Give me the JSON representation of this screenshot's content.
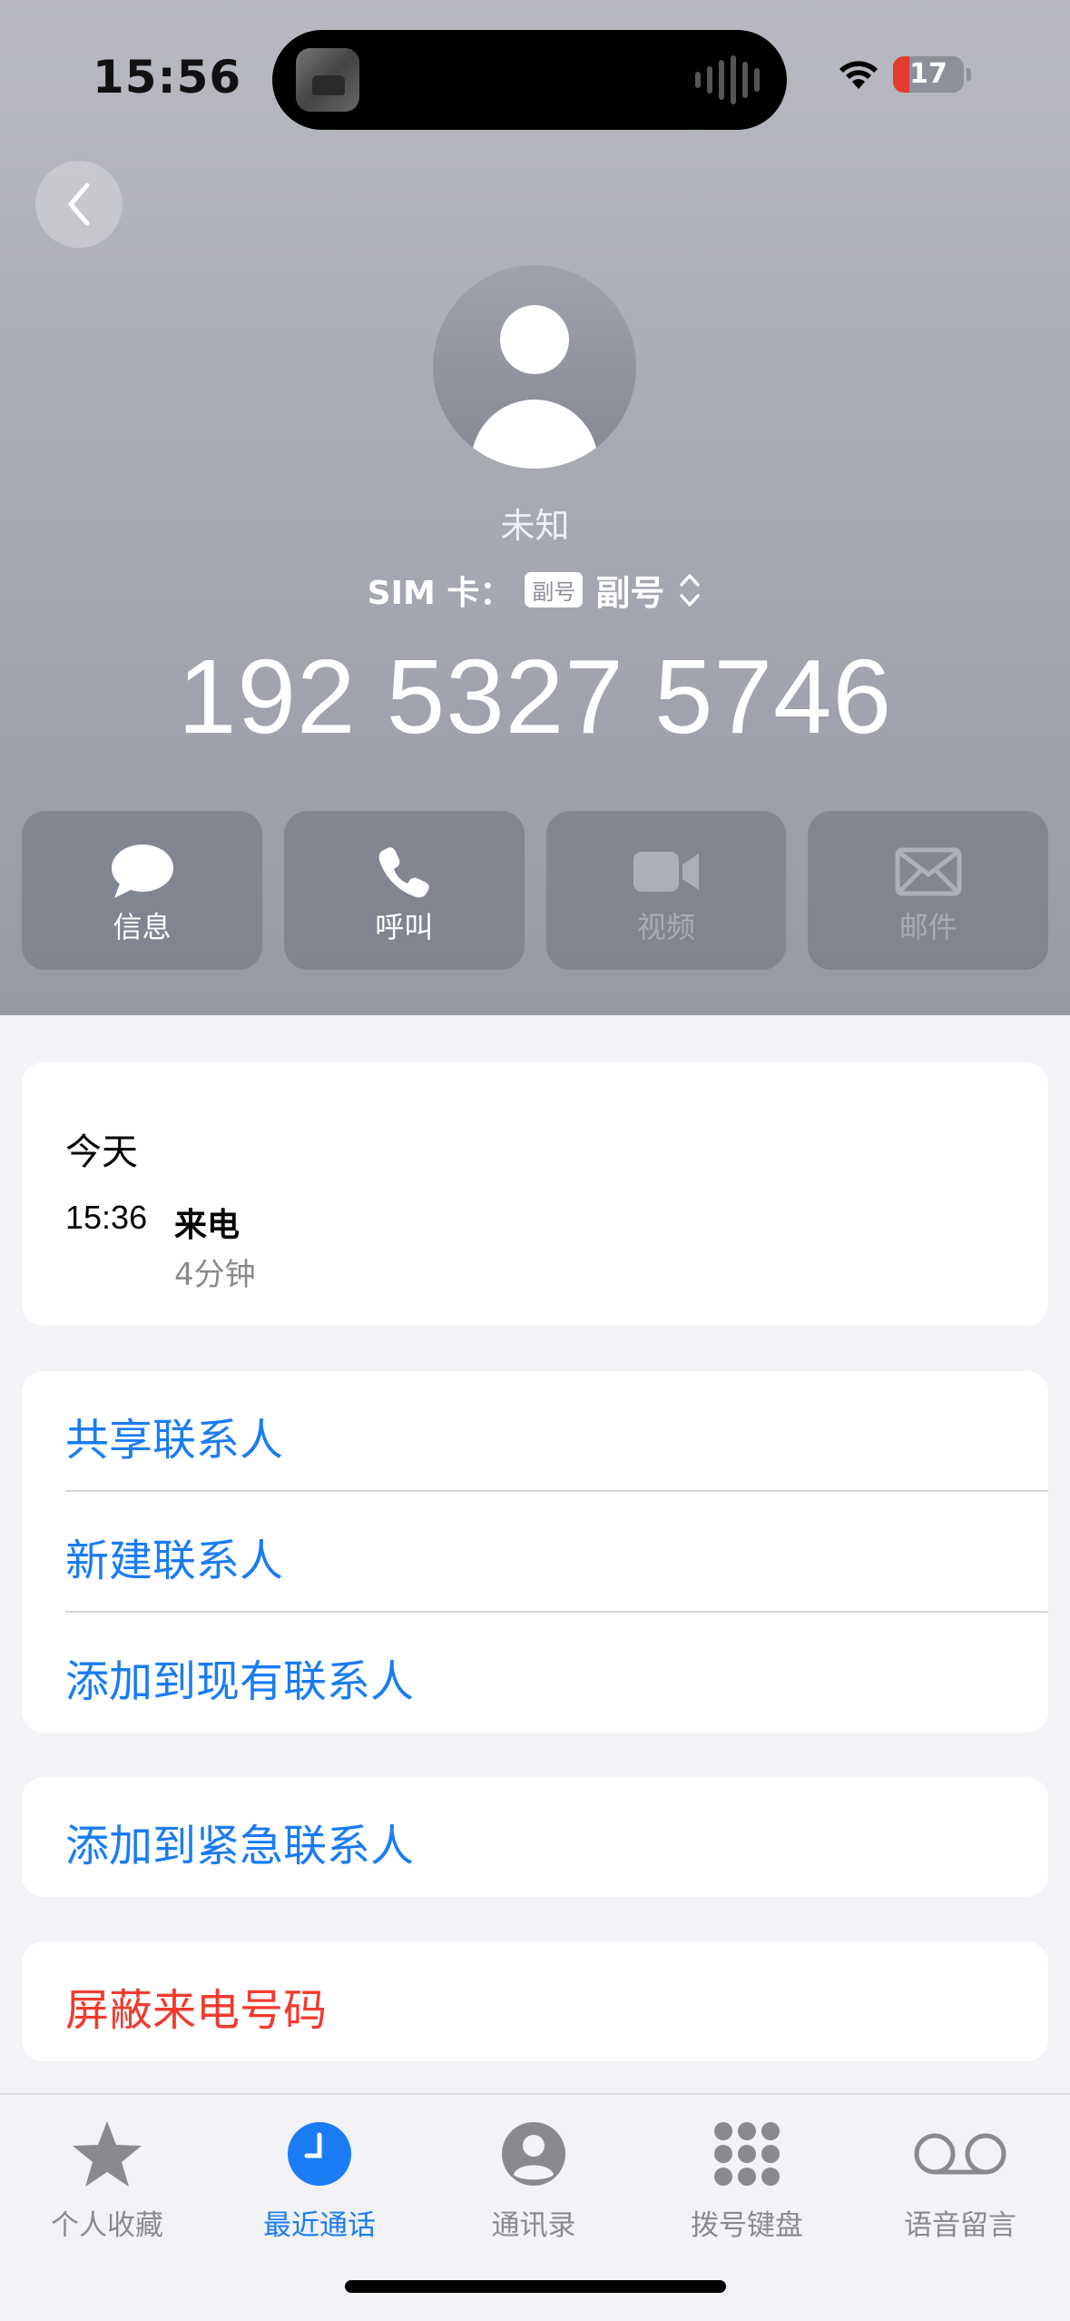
{
  "status_bar": {
    "time": "15:56",
    "battery_level": "17"
  },
  "contact": {
    "name": "未知",
    "sim_label": "SIM 卡：",
    "sim_badge": "副号",
    "sim_value": "副号",
    "number": "192 5327 5746"
  },
  "actions": [
    {
      "label": "信息",
      "icon": "message-icon",
      "enabled": true
    },
    {
      "label": "呼叫",
      "icon": "phone-icon",
      "enabled": true
    },
    {
      "label": "视频",
      "icon": "video-icon",
      "enabled": false
    },
    {
      "label": "邮件",
      "icon": "mail-icon",
      "enabled": false
    }
  ],
  "recent": {
    "day": "今天",
    "time": "15:36",
    "type": "来电",
    "duration": "4分钟"
  },
  "options": {
    "share_contact": "共享联系人",
    "new_contact": "新建联系人",
    "add_existing": "添加到现有联系人",
    "add_emergency": "添加到紧急联系人",
    "block_caller": "屏蔽来电号码"
  },
  "tabs": [
    {
      "label": "个人收藏",
      "icon": "star-icon",
      "active": false
    },
    {
      "label": "最近通话",
      "icon": "clock-icon",
      "active": true
    },
    {
      "label": "通讯录",
      "icon": "contacts-icon",
      "active": false
    },
    {
      "label": "拨号键盘",
      "icon": "keypad-icon",
      "active": false
    },
    {
      "label": "语音留言",
      "icon": "voicemail-icon",
      "active": false
    }
  ],
  "colors": {
    "accent": "#1a7cf5",
    "destructive": "#f23a2f",
    "battery_low": "#e23b2f"
  }
}
